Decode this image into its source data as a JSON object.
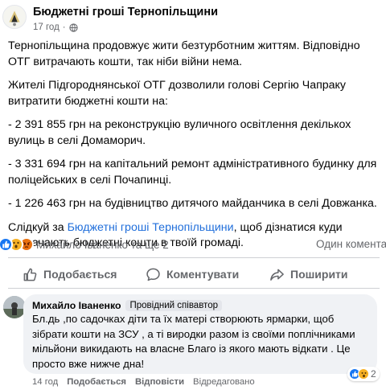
{
  "post": {
    "page_name": "Бюджетні гроші Тернопільщини",
    "time": "17 год",
    "paragraphs": [
      "Тернопільщина продовжує жити безтурботним життям. Відповідно ОТГ витрачають кошти, так ніби війни нема.",
      "Жителі Підгороднянської ОТГ дозволили голові Сергію Чапраку витратити бюджетні кошти на:",
      "- 2 391 855 грн на реконструкцію вуличного освітлення декількох вулиць в селі Домаморич.",
      "- 3 331 694 грн на капітальний ремонт адміністративного будинку для поліцейських в селі Почапинці.",
      "- 1 226 463 грн на будівництво дитячого майданчика в селі Довжанка."
    ],
    "cta_prefix": "Слідкуй за ",
    "cta_link": "Бюджетні гроші Тернопільщини",
    "cta_suffix": ", щоб дізнатися куди витрачають бюджетні кошти в твоїй громаді."
  },
  "reactions": {
    "names": "Михайло Іваненко та ще 2",
    "comment_count": "Один комента"
  },
  "actions": {
    "like": "Подобається",
    "comment": "Коментувати",
    "share": "Поширити"
  },
  "comment": {
    "author": "Михайло Іваненко",
    "badge": "Провідний співавтор",
    "text": "Бл.дь ,по садочках діти та їх матері створюють ярмарки, щоб зібрати кошти на ЗСУ , а ті виродки разом із своїми поплічниками мільйони викидають на власне Благо із якого мають відкати . Це просто вже нижче дна!",
    "reaction_count": "2",
    "time": "14 год",
    "like": "Подобається",
    "reply": "Відповісти",
    "edited": "Відредаговано"
  },
  "colors": {
    "link": "#216fdb",
    "like_blue": "#1877f2",
    "secondary_text": "#65676b",
    "bubble_bg": "#f0f2f5"
  },
  "icons": [
    "page-avatar-logo",
    "globe-icon",
    "like-reaction-icon",
    "wow-reaction-icon",
    "angry-reaction-icon",
    "thumbs-up-icon",
    "comment-icon",
    "share-icon"
  ]
}
